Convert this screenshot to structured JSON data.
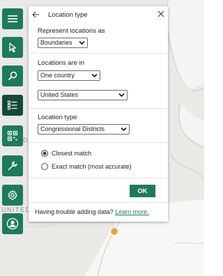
{
  "map": {
    "labels": [
      "CANAD",
      "UNITED S"
    ],
    "marker_color": "#f0a43a"
  },
  "toolbar": {
    "items": [
      {
        "icon": "menu-icon"
      },
      {
        "icon": "cursor-icon"
      },
      {
        "icon": "search-icon"
      },
      {
        "icon": "layer-list-icon",
        "active": true
      },
      {
        "icon": "qr-grid-icon"
      },
      {
        "icon": "wrench-icon"
      },
      {
        "icon": "gear-icon"
      },
      {
        "icon": "user-icon"
      }
    ],
    "color": "#1e7a5d",
    "active_color": "#154a3a"
  },
  "panel": {
    "title": "Location type",
    "represent_label": "Represent locations as",
    "represent_value": "Boundaries",
    "locations_in_label": "Locations are in",
    "locations_in_value": "One country",
    "country_value": "United States",
    "location_type_label": "Location type",
    "location_type_value": "Congressional Districts",
    "match_options": [
      {
        "label": "Closest match",
        "checked": true
      },
      {
        "label": "Exact match (most accurate)",
        "checked": false
      }
    ],
    "ok_label": "OK",
    "footer_text": "Having trouble adding data?",
    "footer_link": "Learn more."
  }
}
